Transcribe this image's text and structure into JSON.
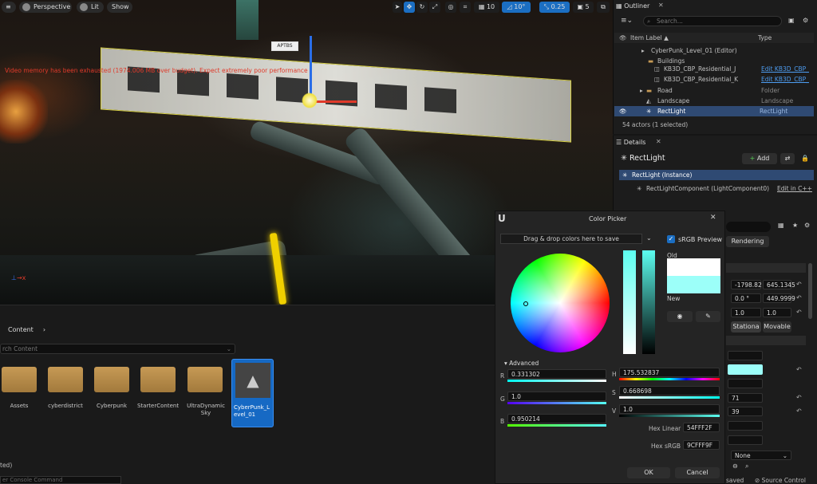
{
  "viewport": {
    "mode": "Perspective",
    "lit": "Lit",
    "show": "Show",
    "grid_snap": "10",
    "rot_snap": "10°",
    "scale_snap": "0.25",
    "cam_speed": "5",
    "warning": "Video memory has been exhausted (1974.006 MB over budget). Expect extremely poor performance"
  },
  "content": {
    "breadcrumb": "Content",
    "search_placeholder": "rch Content",
    "folders": [
      "Assets",
      "cyberdistrict",
      "Cyberpunk",
      "StarterContent",
      "UltraDynamic Sky"
    ],
    "asset": "CyberPunk_Level_01",
    "status": "ted)",
    "console_placeholder": "er Console Command"
  },
  "outliner": {
    "title": "Outliner",
    "search_placeholder": "Search...",
    "col_label": "Item Label ▲",
    "col_type": "Type",
    "items": [
      {
        "label": "CyberPunk_Level_01 (Editor)",
        "type": ""
      },
      {
        "label": "Buildings",
        "type": ""
      },
      {
        "label": "KB3D_CBP_Residential_J",
        "type": "Edit KB3D_CBP_"
      },
      {
        "label": "KB3D_CBP_Residential_K",
        "type": "Edit KB3D_CBP_"
      },
      {
        "label": "Road",
        "type": "Folder"
      },
      {
        "label": "Landscape",
        "type": "Landscape"
      },
      {
        "label": "RectLight",
        "type": "RectLight"
      }
    ],
    "count": "54 actors (1 selected)"
  },
  "details": {
    "title": "Details",
    "object": "RectLight",
    "add": "Add",
    "instance": "RectLight (Instance)",
    "component": "RectLightComponent (LightComponent0)",
    "edit_cpp": "Edit in C++",
    "loc": [
      "-1798.82",
      "645.1345"
    ],
    "rot": [
      "0.0 °",
      "449.9999"
    ],
    "scale": [
      "1.0",
      "1.0"
    ],
    "mobility": [
      "Stationa",
      "Movable"
    ],
    "v1": "71",
    "v2": "39",
    "none": "None",
    "saved": "saved",
    "source": "Source Control"
  },
  "picker": {
    "title": "Color Picker",
    "drop": "Drag & drop colors here to save",
    "srgb": "sRGB Preview",
    "old": "Old",
    "new": "New",
    "advanced": "Advanced",
    "r": "0.331302",
    "g": "1.0",
    "b": "0.950214",
    "h": "175.532837",
    "s": "0.668698",
    "v": "1.0",
    "hex_linear_label": "Hex Linear",
    "hex_linear": "54FFF2F",
    "hex_srgb_label": "Hex sRGB",
    "hex_srgb": "9CFFF9F",
    "ok": "OK",
    "cancel": "Cancel",
    "color_new": "#9cfff9",
    "color_old": "#ffffff"
  }
}
